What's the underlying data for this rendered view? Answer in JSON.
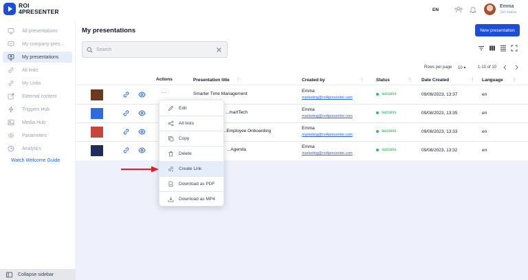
{
  "app": {
    "logo_line1": "ROI",
    "logo_line2": "4PRESENTER",
    "language": "EN",
    "user": {
      "name": "Emma",
      "status": "Set status"
    }
  },
  "sidebar": {
    "items": [
      {
        "label": "All presentations",
        "icon": "screen-icon",
        "active": false
      },
      {
        "label": "My company pres...",
        "icon": "building-screen-icon",
        "active": false
      },
      {
        "label": "My presentations",
        "icon": "user-screen-icon",
        "active": true
      },
      {
        "label": "All links",
        "icon": "link-icon",
        "active": false
      },
      {
        "label": "My Links",
        "icon": "user-link-icon",
        "active": false
      },
      {
        "label": "External content",
        "icon": "external-icon",
        "active": false
      },
      {
        "label": "Triggers Hub",
        "icon": "lightning-icon",
        "active": false
      },
      {
        "label": "Media Hub",
        "icon": "image-icon",
        "active": false
      },
      {
        "label": "Parameters",
        "icon": "gear-icon",
        "active": false
      },
      {
        "label": "Analytics",
        "icon": "chart-icon",
        "active": false
      }
    ],
    "welcome_guide": "Watch Welcome Guide",
    "collapse": "Collapse sidebar"
  },
  "main": {
    "title": "My presentations",
    "new_button": "New presentation",
    "search_placeholder": "Search",
    "rows_per_page_label": "Rows per page",
    "rows_per_page_value": "10",
    "range": "1-10 of 10",
    "columns": [
      "Actions",
      "Presentation title",
      "Created by",
      "Status",
      "Date Created",
      "Language"
    ],
    "rows": [
      {
        "title": "Smarter Time Management",
        "creator": "Emma",
        "email": "marketing@roi4presenter.com",
        "status": "success",
        "date": "09/08/2023, 13:37",
        "lang": "en",
        "thumb_color": "#6b3a1e"
      },
      {
        "title": "...martTech",
        "creator": "Emma",
        "email": "marketing@roi4presenter.com",
        "status": "success",
        "date": "09/08/2023, 13:35",
        "lang": "en",
        "thumb_color": "#2f6be0"
      },
      {
        "title": "...Employee Onboarding",
        "creator": "Emma",
        "email": "marketing@roi4presenter.com",
        "status": "success",
        "date": "09/08/2023, 13:33",
        "lang": "en",
        "thumb_color": "#c8453c"
      },
      {
        "title": "...Agenda",
        "creator": "Emma",
        "email": "marketing@roi4presenter.com",
        "status": "success",
        "date": "09/08/2023, 13:32",
        "lang": "en",
        "thumb_color": "#1f2d5a"
      }
    ]
  },
  "menu": {
    "items": [
      {
        "label": "Edit",
        "icon": "pencil-icon"
      },
      {
        "label": "All links",
        "icon": "share-icon"
      },
      {
        "label": "Copy",
        "icon": "copy-icon"
      },
      {
        "label": "Delete",
        "icon": "trash-icon"
      },
      {
        "label": "Create Link",
        "icon": "add-link-icon",
        "highlighted": true
      },
      {
        "label": "Download as PDF",
        "icon": "pdf-icon"
      },
      {
        "label": "Download as MP4",
        "icon": "download-icon"
      }
    ]
  },
  "colors": {
    "primary": "#1d4ed8",
    "success": "#22c55e",
    "arrow": "#e11d2a",
    "highlight": "#e6edfa"
  }
}
